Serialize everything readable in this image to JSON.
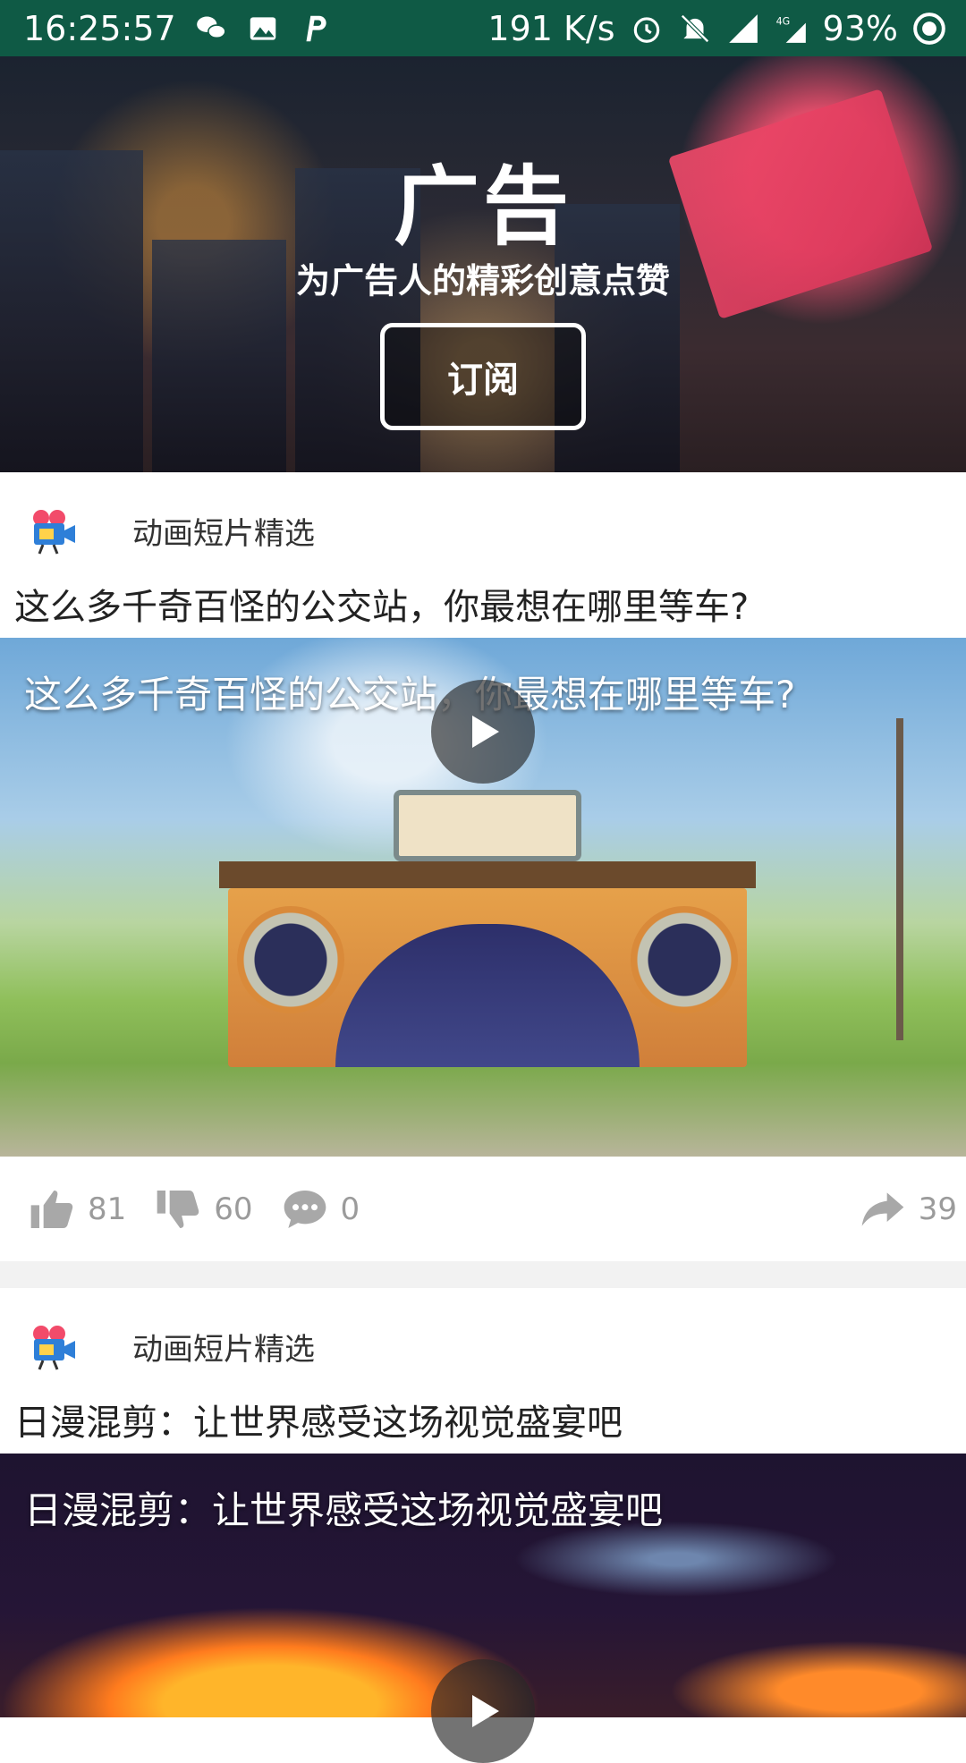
{
  "status_bar": {
    "time": "16:25:57",
    "net_speed": "191 K/s",
    "battery": "93%",
    "net_type": "4G"
  },
  "banner": {
    "title": "广告",
    "subtitle": "为广告人的精彩创意点赞",
    "subscribe_label": "订阅"
  },
  "feed": {
    "cards": [
      {
        "channel": "动画短片精选",
        "title": "这么多千奇百怪的公交站，你最想在哪里等车?",
        "video_caption": "这么多千奇百怪的公交站，你最想在哪里等车?",
        "likes": "81",
        "dislikes": "60",
        "comments": "0",
        "shares": "39"
      },
      {
        "channel": "动画短片精选",
        "title": "日漫混剪：让世界感受这场视觉盛宴吧",
        "video_caption": "日漫混剪：让世界感受这场视觉盛宴吧"
      }
    ]
  },
  "icons": {
    "wechat": "wechat-icon",
    "image": "image-icon",
    "p_app": "p-app-icon",
    "alarm": "alarm-icon",
    "mute": "bell-off-icon",
    "signal": "signal-icon",
    "battery": "battery-icon",
    "channel": "video-camera-icon",
    "play": "play-icon",
    "like": "thumbs-up-icon",
    "dislike": "thumbs-down-icon",
    "comment": "comment-icon",
    "share": "share-icon"
  }
}
